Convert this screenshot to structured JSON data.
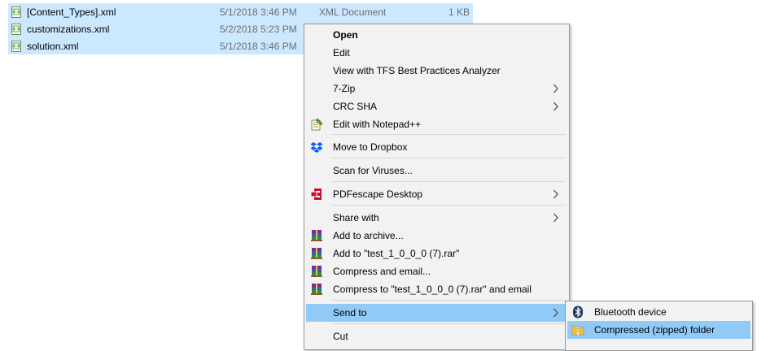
{
  "files": [
    {
      "name": "[Content_Types].xml",
      "date": "5/1/2018 3:46 PM",
      "type": "XML Document",
      "size": "1 KB"
    },
    {
      "name": "customizations.xml",
      "date": "5/2/2018 5:23 PM",
      "type": "",
      "size": ""
    },
    {
      "name": "solution.xml",
      "date": "5/1/2018 3:46 PM",
      "type": "",
      "size": ""
    }
  ],
  "context_menu": {
    "items": [
      {
        "label": "Open",
        "icon": "",
        "bold": true
      },
      {
        "label": "Edit",
        "icon": ""
      },
      {
        "label": "View with TFS Best Practices Analyzer",
        "icon": ""
      },
      {
        "label": "7-Zip",
        "icon": "",
        "submenu": true
      },
      {
        "label": "CRC SHA",
        "icon": "",
        "submenu": true
      },
      {
        "label": "Edit with Notepad++",
        "icon": "notepad-plus-plus-icon"
      },
      {
        "label": "Move to Dropbox",
        "icon": "dropbox-icon"
      },
      {
        "label": "Scan for Viruses...",
        "icon": ""
      },
      {
        "label": "PDFescape Desktop",
        "icon": "pdfescape-icon",
        "submenu": true
      },
      {
        "label": "Share with",
        "icon": "",
        "submenu": true
      },
      {
        "label": "Add to archive...",
        "icon": "winrar-icon"
      },
      {
        "label": "Add to \"test_1_0_0_0 (7).rar\"",
        "icon": "winrar-icon"
      },
      {
        "label": "Compress and email...",
        "icon": "winrar-icon"
      },
      {
        "label": "Compress to \"test_1_0_0_0 (7).rar\" and email",
        "icon": "winrar-icon"
      },
      {
        "label": "Send to",
        "icon": "",
        "submenu": true,
        "highlighted": true
      },
      {
        "label": "Cut",
        "icon": ""
      }
    ]
  },
  "send_to_submenu": {
    "items": [
      {
        "label": "Bluetooth device",
        "icon": "bluetooth-icon"
      },
      {
        "label": "Compressed (zipped) folder",
        "icon": "zip-folder-icon",
        "highlighted": true
      }
    ]
  },
  "colors": {
    "selection": "#cce8ff",
    "menu_background": "#f2f2f2",
    "menu_highlight": "#91c9f7"
  }
}
